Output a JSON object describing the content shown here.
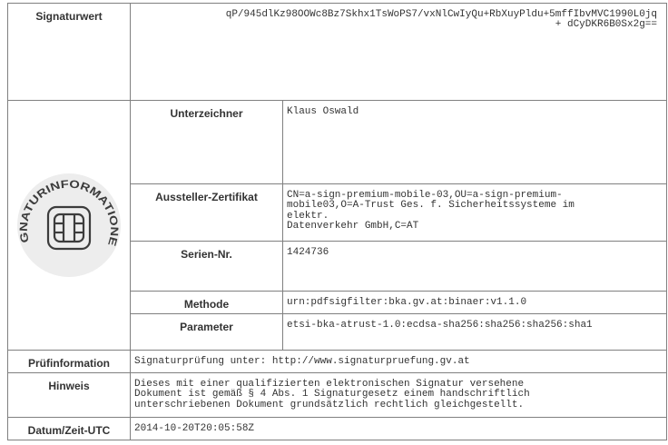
{
  "signature_block": {
    "signaturwert": {
      "label": "Signaturwert",
      "value": "qP/945dlKz98OOWc8Bz7Skhx1TsWoPS7/vxNlCwIyQu+RbXuyPldu+5mffIbvMVC1990L0jq\n+ dCyDKR6B0Sx2g=="
    },
    "logo": {
      "seal_text": "SIGNATURINFORMATIONEN",
      "icon": "chip-card-icon"
    },
    "unterzeichner": {
      "label": "Unterzeichner",
      "value": "Klaus Oswald"
    },
    "aussteller": {
      "label": "Aussteller-Zertifikat",
      "value": "CN=a-sign-premium-mobile-03,OU=a-sign-premium-\nmobile03,O=A-Trust Ges. f. Sicherheitssysteme im\nelektr.\nDatenverkehr GmbH,C=AT"
    },
    "serien_nr": {
      "label": "Serien-Nr.",
      "value": "1424736"
    },
    "methode": {
      "label": "Methode",
      "value": "urn:pdfsigfilter:bka.gv.at:binaer:v1.1.0"
    },
    "parameter": {
      "label": "Parameter",
      "value": "etsi-bka-atrust-1.0:ecdsa-sha256:sha256:sha256:sha1"
    },
    "pruefinformation": {
      "label": "Prüfinformation",
      "value": "Signaturprüfung unter: http://www.signaturpruefung.gv.at"
    },
    "hinweis": {
      "label": "Hinweis",
      "value": "Dieses mit einer qualifizierten elektronischen Signatur versehene\nDokument ist gemäß § 4 Abs. 1 Signaturgesetz einem handschriftlich\nunterschriebenen Dokument grundsätzlich rechtlich gleichgestellt."
    },
    "datum": {
      "label": "Datum/Zeit-UTC",
      "value": "2014-10-20T20:05:58Z"
    }
  },
  "colors": {
    "border": "#808080",
    "label_text": "#1a1a1a",
    "value_text": "#444444",
    "logo_gray": "#3c3c3c",
    "logo_fill": "#ededed"
  }
}
